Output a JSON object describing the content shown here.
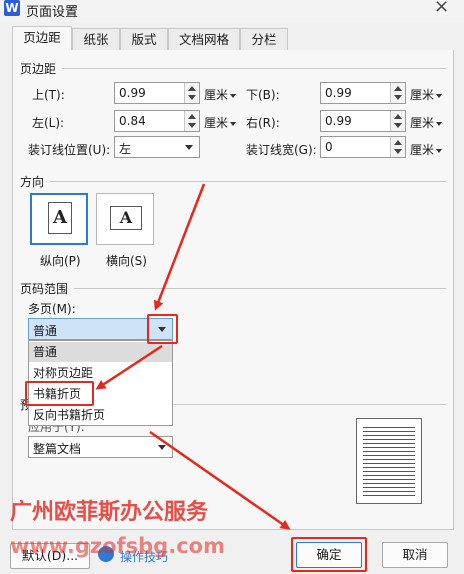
{
  "window": {
    "app_icon": "W",
    "title": "页面设置",
    "close_glyph": "×"
  },
  "tabs": [
    {
      "label": "页边距",
      "active": true
    },
    {
      "label": "纸张"
    },
    {
      "label": "版式"
    },
    {
      "label": "文档网格"
    },
    {
      "label": "分栏"
    }
  ],
  "margins": {
    "section": "页边距",
    "top": {
      "label": "上(T):",
      "value": "0.99",
      "unit": "厘米"
    },
    "bottom": {
      "label": "下(B):",
      "value": "0.99",
      "unit": "厘米"
    },
    "left": {
      "label": "左(L):",
      "value": "0.84",
      "unit": "厘米"
    },
    "right": {
      "label": "右(R):",
      "value": "0.99",
      "unit": "厘米"
    },
    "gutter_pos": {
      "label": "装订线位置(U):",
      "value": "左"
    },
    "gutter": {
      "label": "装订线宽(G):",
      "value": "0",
      "unit": "厘米"
    }
  },
  "orientation": {
    "section": "方向",
    "glyph": "A",
    "portrait": "纵向(P)",
    "landscape": "横向(S)"
  },
  "pages": {
    "section": "页码范围",
    "multi_label": "多页(M):",
    "multi_value": "普通",
    "options": [
      "普通",
      "对称页边距",
      "书籍折页",
      "反向书籍折页"
    ],
    "hidden_section_char": "预",
    "apply_label": "应用于(Y):",
    "apply_value": "整篇文档"
  },
  "footer": {
    "default": "默认(D)...",
    "tips": "操作技巧",
    "ok": "确定",
    "cancel": "取消"
  },
  "watermark": {
    "line1": "广州欧菲斯办公服务",
    "line2": "www.gzofsbg.com"
  },
  "colors": {
    "annotation_red": "#e32a1f",
    "selection_blue": "#2f78d4",
    "dropdown_blue": "#cfe3f7"
  }
}
